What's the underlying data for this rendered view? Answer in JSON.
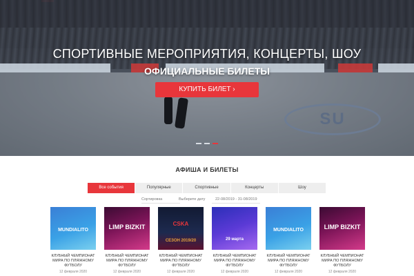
{
  "hero": {
    "title": "СПОРТИВНЫЕ МЕРОПРИЯТИЯ, КОНЦЕРТЫ, ШОУ",
    "subtitle": "ОФИЦИАЛЬНЫЕ БИЛЕТЫ",
    "buy_button": "КУПИТЬ БИЛЕТ  ›",
    "slides_count": 3,
    "active_slide": 3
  },
  "section": {
    "title": "АФИША И БИЛЕТЫ",
    "tabs": [
      {
        "label": "Все события",
        "active": true
      },
      {
        "label": "Популярные",
        "active": false
      },
      {
        "label": "Спортивные",
        "active": false
      },
      {
        "label": "Концерты",
        "active": false
      },
      {
        "label": "Шоу",
        "active": false
      }
    ],
    "filters": {
      "sort_label": "Сортировка",
      "date_label": "Выберите дату",
      "date_range": "22-08/2019 - 31-08/2019"
    }
  },
  "cards": [
    {
      "poster": "blue",
      "poster_text": "MUNDIALITO",
      "title": "КЛУБНЫЙ ЧЕМПИОНАТ МИРА ПО ПЛЯЖНОМУ ФУТБОЛУ",
      "date": "12 февраля 2020"
    },
    {
      "poster": "limp",
      "poster_text": "LIMP BIZKIT",
      "title": "КЛУБНЫЙ ЧЕМПИОНАТ МИРА ПО ПЛЯЖНОМУ ФУТБОЛУ",
      "date": "12 февраля 2020"
    },
    {
      "poster": "cska",
      "poster_text": "CSKA",
      "poster_text2": "СЕЗОН 2019/20",
      "title": "КЛУБНЫЙ ЧЕМПИОНАТ МИРА ПО ПЛЯЖНОМУ ФУТБОЛУ",
      "date": "12 февраля 2020"
    },
    {
      "poster": "event",
      "poster_text": "29 марта",
      "title": "КЛУБНЫЙ ЧЕМПИОНАТ МИРА ПО ПЛЯЖНОМУ ФУТБОЛУ",
      "date": "12 февраля 2020"
    },
    {
      "poster": "blue",
      "poster_text": "MUNDIALITO",
      "title": "КЛУБНЫЙ ЧЕМПИОНАТ МИРА ПО ПЛЯЖНОМУ ФУТБОЛУ",
      "date": "12 февраля 2020"
    },
    {
      "poster": "limp",
      "poster_text": "LIMP BIZKIT",
      "title": "КЛУБНЫЙ ЧЕМПИОНАТ МИРА ПО ПЛЯЖНОМУ ФУТБОЛУ",
      "date": "12 февраля 2020"
    }
  ],
  "colors": {
    "accent": "#e8363b",
    "tab_bg": "#eeeeee"
  }
}
